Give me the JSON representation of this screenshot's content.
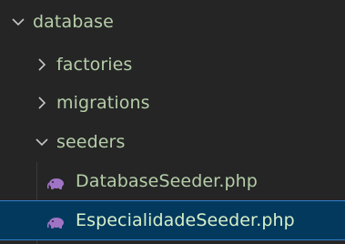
{
  "explorer": {
    "items": [
      {
        "label": "database",
        "kind": "folder",
        "expanded": true,
        "depth": 0,
        "icon": "chevron-down-icon"
      },
      {
        "label": "factories",
        "kind": "folder",
        "expanded": false,
        "depth": 1,
        "icon": "chevron-right-icon"
      },
      {
        "label": "migrations",
        "kind": "folder",
        "expanded": false,
        "depth": 1,
        "icon": "chevron-right-icon"
      },
      {
        "label": "seeders",
        "kind": "folder",
        "expanded": true,
        "depth": 1,
        "icon": "chevron-down-icon"
      },
      {
        "label": "DatabaseSeeder.php",
        "kind": "file",
        "depth": 2,
        "icon": "php-elephant-icon"
      },
      {
        "label": "EspecialidadeSeeder.php",
        "kind": "file",
        "depth": 2,
        "icon": "php-elephant-icon",
        "selected": true
      }
    ]
  },
  "colors": {
    "background": "#252526",
    "text": "#b5cea8",
    "selection_bg": "#04395e",
    "selection_border": "#2f80c8",
    "php_icon": "#a074c4",
    "chevron": "#c5c5c5"
  }
}
